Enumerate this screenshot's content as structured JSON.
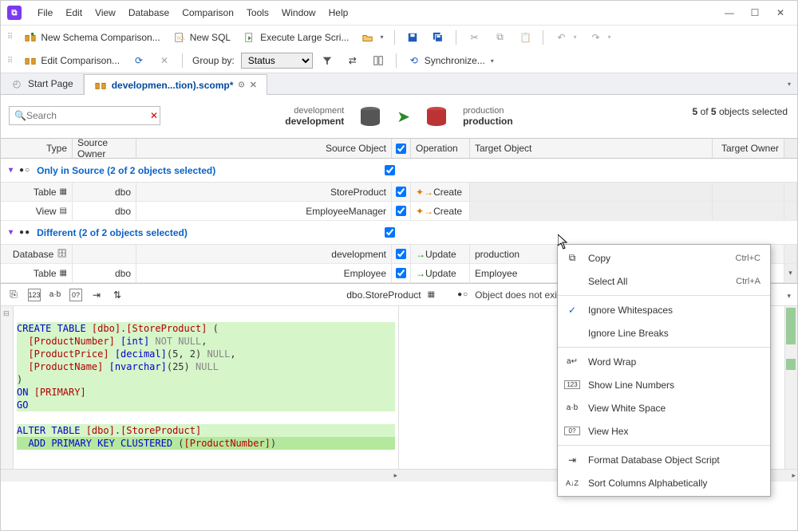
{
  "menus": [
    "File",
    "Edit",
    "View",
    "Database",
    "Comparison",
    "Tools",
    "Window",
    "Help"
  ],
  "toolbar1": {
    "newSchema": "New Schema Comparison...",
    "newSql": "New SQL",
    "execLarge": "Execute Large Scri..."
  },
  "toolbar2": {
    "editComp": "Edit Comparison...",
    "groupByLabel": "Group by:",
    "groupByValue": "Status",
    "sync": "Synchronize..."
  },
  "tabs": {
    "start": "Start Page",
    "active": "developmen...tion).scomp*"
  },
  "search": {
    "placeholder": "Search"
  },
  "compare": {
    "left": {
      "title": "development",
      "bold": "development"
    },
    "right": {
      "title": "production",
      "bold": "production"
    },
    "selectedA": "5",
    "of": " of ",
    "selectedB": "5",
    "tail": " objects selected"
  },
  "gridHeaders": {
    "type": "Type",
    "sowner": "Source Owner",
    "sobj": "Source Object",
    "op": "Operation",
    "tobj": "Target Object",
    "towner": "Target Owner"
  },
  "groups": {
    "onlySource": "Only in Source (2 of 2 objects selected)",
    "different": "Different (2 of 2 objects selected)"
  },
  "rows": {
    "r1": {
      "type": "Table",
      "owner": "dbo",
      "obj": "StoreProduct",
      "op": "Create"
    },
    "r2": {
      "type": "View",
      "owner": "dbo",
      "obj": "EmployeeManager",
      "op": "Create"
    },
    "r3": {
      "type": "Database",
      "owner": "",
      "obj": "development",
      "op": "Update",
      "tobj": "production"
    },
    "r4": {
      "type": "Table",
      "owner": "dbo",
      "obj": "Employee",
      "op": "Update",
      "tobj": "Employee"
    }
  },
  "editor": {
    "leftHeader": "dbo.StoreProduct",
    "rightHeader": "Object does not exist",
    "code": {
      "l1a": "CREATE TABLE ",
      "l1b": "[dbo]",
      "l1c": ".",
      "l1d": "[StoreProduct]",
      "l1e": " (",
      "l2a": "  [ProductNumber] ",
      "l2b": "[int]",
      "l2c": " NOT NULL",
      "l2d": ",",
      "l3a": "  [ProductPrice] ",
      "l3b": "[decimal]",
      "l3c": "(",
      "l3d": "5",
      "l3e": ", ",
      "l3f": "2",
      "l3g": ")",
      "l3h": " NULL",
      "l3i": ",",
      "l4a": "  [ProductName] ",
      "l4b": "[nvarchar]",
      "l4c": "(",
      "l4d": "25",
      "l4e": ")",
      "l4f": " NULL",
      "l5": ")",
      "l6a": "ON ",
      "l6b": "[PRIMARY]",
      "l7": "GO",
      "l8": "",
      "l9a": "ALTER TABLE ",
      "l9b": "[dbo]",
      "l9c": ".",
      "l9d": "[StoreProduct]",
      "l10a": "  ADD PRIMARY KEY CLUSTERED ",
      "l10b": "(",
      "l10c": "[ProductNumber]",
      "l10d": ")"
    }
  },
  "ctx": {
    "copy": "Copy",
    "copyShort": "Ctrl+C",
    "selectAll": "Select All",
    "selectAllShort": "Ctrl+A",
    "ignoreWs": "Ignore Whitespaces",
    "ignoreLb": "Ignore Line Breaks",
    "wordWrap": "Word Wrap",
    "lineNums": "Show Line Numbers",
    "viewWs": "View White Space",
    "viewHex": "View Hex",
    "formatDbo": "Format Database Object Script",
    "sortCols": "Sort Columns Alphabetically"
  }
}
